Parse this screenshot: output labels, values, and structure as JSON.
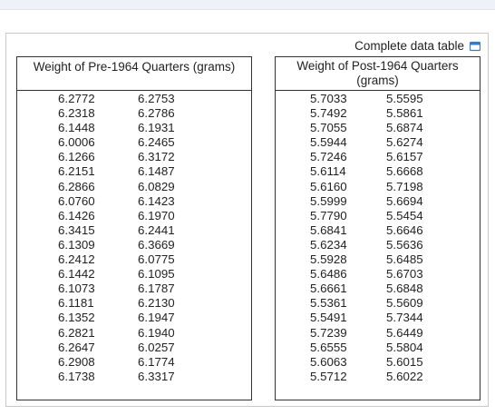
{
  "link": {
    "label": "Complete data table"
  },
  "pre": {
    "header": "Weight of Pre-1964 Quarters (grams)",
    "rows": [
      [
        "6.2772",
        "6.2753"
      ],
      [
        "6.2318",
        "6.2786"
      ],
      [
        "6.1448",
        "6.1931"
      ],
      [
        "6.0006",
        "6.2465"
      ],
      [
        "6.1266",
        "6.3172"
      ],
      [
        "6.2151",
        "6.1487"
      ],
      [
        "6.2866",
        "6.0829"
      ],
      [
        "6.0760",
        "6.1423"
      ],
      [
        "6.1426",
        "6.1970"
      ],
      [
        "6.3415",
        "6.2441"
      ],
      [
        "6.1309",
        "6.3669"
      ],
      [
        "6.2412",
        "6.0775"
      ],
      [
        "6.1442",
        "6.1095"
      ],
      [
        "6.1073",
        "6.1787"
      ],
      [
        "6.1181",
        "6.2130"
      ],
      [
        "6.1352",
        "6.1947"
      ],
      [
        "6.2821",
        "6.1940"
      ],
      [
        "6.2647",
        "6.0257"
      ],
      [
        "6.2908",
        "6.1774"
      ],
      [
        "6.1738",
        "6.3317"
      ]
    ]
  },
  "post": {
    "header": "Weight of Post-1964 Quarters (grams)",
    "rows": [
      [
        "5.7033",
        "5.5595"
      ],
      [
        "5.7492",
        "5.5861"
      ],
      [
        "5.7055",
        "5.6874"
      ],
      [
        "5.5944",
        "5.6274"
      ],
      [
        "5.7246",
        "5.6157"
      ],
      [
        "5.6114",
        "5.6668"
      ],
      [
        "5.6160",
        "5.7198"
      ],
      [
        "5.5999",
        "5.6694"
      ],
      [
        "5.7790",
        "5.5454"
      ],
      [
        "5.6841",
        "5.6646"
      ],
      [
        "5.6234",
        "5.5636"
      ],
      [
        "5.5928",
        "5.6485"
      ],
      [
        "5.6486",
        "5.6703"
      ],
      [
        "5.6661",
        "5.6848"
      ],
      [
        "5.5361",
        "5.5609"
      ],
      [
        "5.5491",
        "5.7344"
      ],
      [
        "5.7239",
        "5.6449"
      ],
      [
        "5.6555",
        "5.5804"
      ],
      [
        "5.6063",
        "5.6015"
      ],
      [
        "5.5712",
        "5.6022"
      ]
    ]
  }
}
